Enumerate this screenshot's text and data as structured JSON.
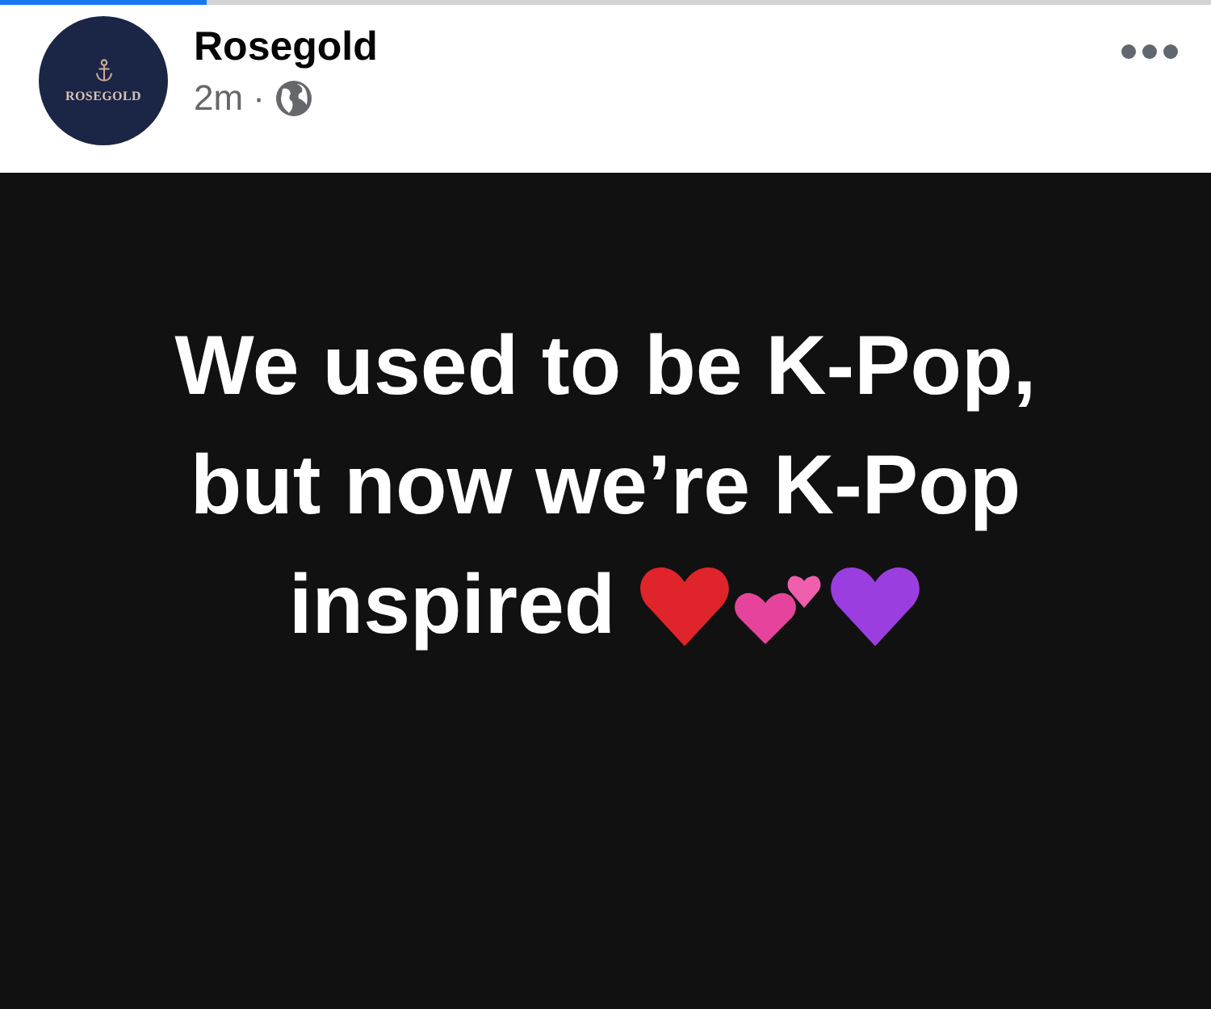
{
  "loading_bar": {
    "level": 0.17
  },
  "post": {
    "avatar_label": "ROSEGOLD",
    "author": "Rosegold",
    "time": "2m",
    "separator": "·"
  },
  "status_lines": [
    "We used to be K-Pop,",
    "but now we’re K-Pop",
    "inspired"
  ]
}
